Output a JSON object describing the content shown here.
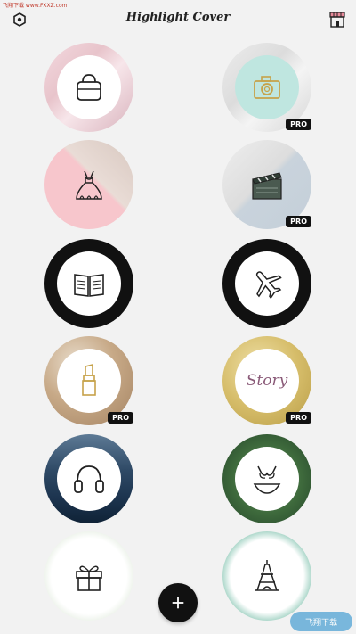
{
  "app": {
    "title": "Highlight Cover",
    "watermark_top": "飞翔下载 www.FXXZ.com",
    "watermark_bottom": "飞翔下载"
  },
  "header": {
    "settings_icon": "hexagon-settings-icon",
    "store_icon": "store-icon"
  },
  "covers": [
    {
      "id": "handbag",
      "icon": "handbag-icon",
      "pro": false
    },
    {
      "id": "camera",
      "icon": "camera-icon",
      "pro": true,
      "badge": "PRO"
    },
    {
      "id": "dress",
      "icon": "dress-icon",
      "pro": false
    },
    {
      "id": "clapperboard",
      "icon": "clapperboard-icon",
      "pro": true,
      "badge": "PRO"
    },
    {
      "id": "book",
      "icon": "book-icon",
      "pro": false
    },
    {
      "id": "airplane",
      "icon": "airplane-icon",
      "pro": false
    },
    {
      "id": "lipstick",
      "icon": "lipstick-icon",
      "pro": true,
      "badge": "PRO"
    },
    {
      "id": "story",
      "icon": "story-text",
      "label": "Story",
      "pro": true,
      "badge": "PRO"
    },
    {
      "id": "headphones",
      "icon": "headphones-icon",
      "pro": false
    },
    {
      "id": "bikini",
      "icon": "bikini-icon",
      "pro": false
    },
    {
      "id": "gift",
      "icon": "gift-icon",
      "pro": false
    },
    {
      "id": "eiffel",
      "icon": "eiffel-tower-icon",
      "pro": false
    }
  ],
  "fab": {
    "icon": "plus-icon"
  },
  "colors": {
    "background": "#f2f2f2",
    "fab": "#111111",
    "pro_badge": "#111111",
    "accent_pink": "#f7c6cc"
  }
}
